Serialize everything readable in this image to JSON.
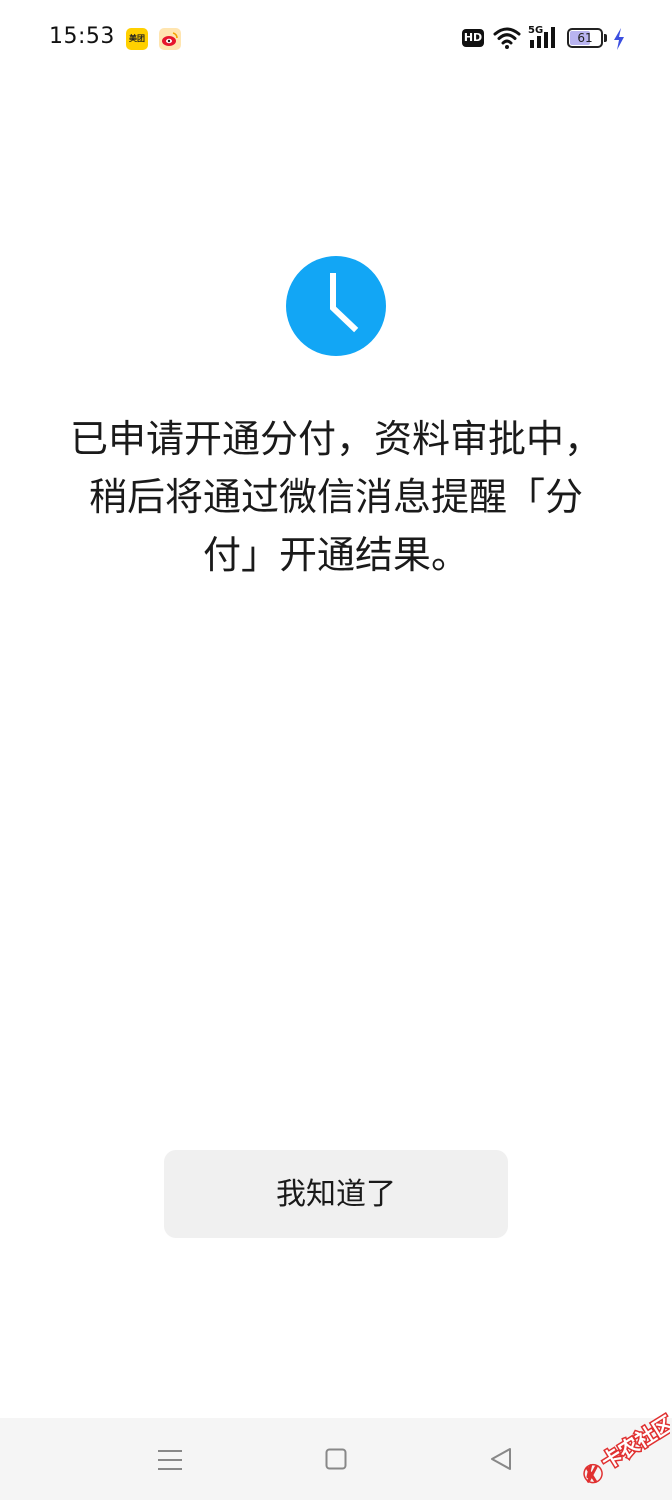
{
  "status_bar": {
    "time": "15:53",
    "apps": [
      "meituan-icon",
      "weibo-icon"
    ],
    "hd_label": "HD",
    "network_label": "5G",
    "battery_level": "61"
  },
  "main": {
    "icon": "clock-icon",
    "accent_color": "#12a6f5",
    "message_lines": [
      "已申请开通分付，资料审批中，",
      "稍后将通过微信消息提醒「分",
      "付」开通结果。"
    ]
  },
  "actions": {
    "acknowledge_label": "我知道了"
  },
  "nav_bar": {
    "buttons": [
      "menu-icon",
      "home-icon",
      "back-icon"
    ]
  },
  "watermark": {
    "text": "卡农社区"
  }
}
